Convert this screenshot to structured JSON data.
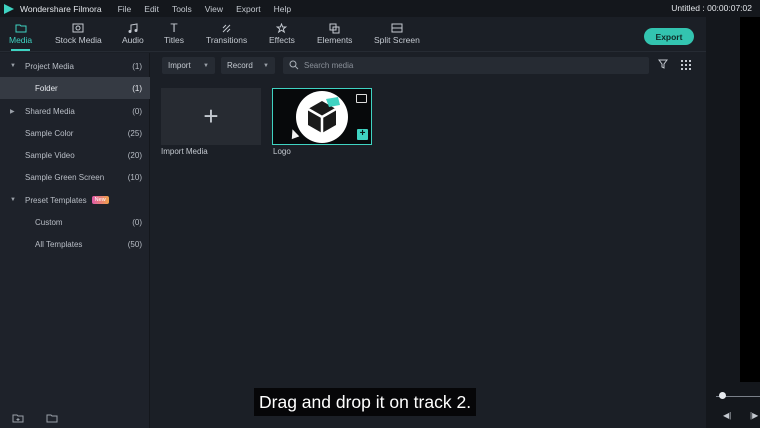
{
  "app": {
    "name": "Wondershare Filmora",
    "project_timecode": "Untitled : 00:00:07:02"
  },
  "menu": [
    "File",
    "Edit",
    "Tools",
    "View",
    "Export",
    "Help"
  ],
  "tabs": [
    {
      "label": "Media",
      "icon": "folder-icon",
      "active": true
    },
    {
      "label": "Stock Media",
      "icon": "stock-media-icon",
      "active": false
    },
    {
      "label": "Audio",
      "icon": "music-note-icon",
      "active": false
    },
    {
      "label": "Titles",
      "icon": "text-t-icon",
      "active": false
    },
    {
      "label": "Transitions",
      "icon": "transitions-icon",
      "active": false
    },
    {
      "label": "Effects",
      "icon": "effects-icon",
      "active": false
    },
    {
      "label": "Elements",
      "icon": "elements-icon",
      "active": false
    },
    {
      "label": "Split Screen",
      "icon": "split-screen-icon",
      "active": false
    }
  ],
  "export_label": "Export",
  "sidebar": {
    "items": [
      {
        "label": "Project Media",
        "count": "(1)",
        "expanded": true
      },
      {
        "label": "Folder",
        "count": "(1)",
        "selected": true
      },
      {
        "label": "Shared Media",
        "count": "(0)",
        "expanded": false
      },
      {
        "label": "Sample Color",
        "count": "(25)"
      },
      {
        "label": "Sample Video",
        "count": "(20)"
      },
      {
        "label": "Sample Green Screen",
        "count": "(10)"
      },
      {
        "label": "Preset Templates",
        "count": "",
        "badge": "New",
        "expanded": true
      },
      {
        "label": "Custom",
        "count": "(0)"
      },
      {
        "label": "All Templates",
        "count": "(50)"
      }
    ]
  },
  "toolbar": {
    "import_label": "Import",
    "record_label": "Record",
    "search_placeholder": "Search media"
  },
  "media_items": [
    {
      "caption": "Import Media",
      "type": "import"
    },
    {
      "caption": "Logo",
      "type": "image"
    }
  ],
  "subtitle": "Drag and drop it on track 2.",
  "colors": {
    "accent": "#3fd3c2",
    "background": "#1b1f26",
    "panel": "#1e222a",
    "selected_row": "#353a43"
  }
}
